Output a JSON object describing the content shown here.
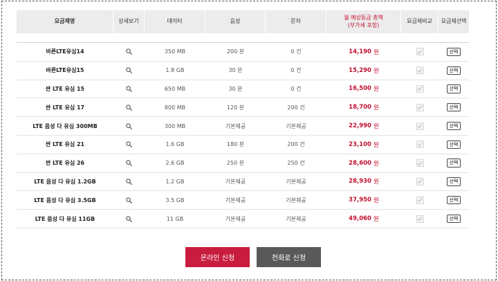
{
  "table": {
    "headers": {
      "plan": "요금제명",
      "detail": "상세보기",
      "data": "데이터",
      "voice": "음성",
      "sms": "문자",
      "monthly_line1": "월 예상동급 총액",
      "monthly_line2": "(부가세 포함)",
      "compare": "요금제비교",
      "select": "요금제선택"
    },
    "select_label": "선택",
    "won_unit": "원",
    "rows": [
      {
        "plan": "바른LTE유심14",
        "data": "350 MB",
        "voice": "200 분",
        "sms": "0 건",
        "price": "14,190"
      },
      {
        "plan": "바른LTE유심15",
        "data": "1.8 GB",
        "voice": "30 분",
        "sms": "0 건",
        "price": "15,290"
      },
      {
        "plan": "싼 LTE 유심 15",
        "data": "650 MB",
        "voice": "30 분",
        "sms": "0 건",
        "price": "16,500"
      },
      {
        "plan": "싼 LTE 유심 17",
        "data": "800 MB",
        "voice": "120 분",
        "sms": "200 건",
        "price": "18,700"
      },
      {
        "plan": "LTE 음성 다 유심 300MB",
        "data": "300 MB",
        "voice": "기본제공",
        "sms": "기본제공",
        "price": "22,990"
      },
      {
        "plan": "싼 LTE 유심 21",
        "data": "1.6 GB",
        "voice": "180 분",
        "sms": "200 건",
        "price": "23,100"
      },
      {
        "plan": "싼 LTE 유심 26",
        "data": "2.6 GB",
        "voice": "250 분",
        "sms": "250 건",
        "price": "28,600"
      },
      {
        "plan": "LTE 음성 다 유심 1.2GB",
        "data": "1.2 GB",
        "voice": "기본제공",
        "sms": "기본제공",
        "price": "28,930"
      },
      {
        "plan": "LTE 음성 다 유심 3.5GB",
        "data": "3.5 GB",
        "voice": "기본제공",
        "sms": "기본제공",
        "price": "37,950"
      },
      {
        "plan": "LTE 음성 다 유심 11GB",
        "data": "11 GB",
        "voice": "기본제공",
        "sms": "기본제공",
        "price": "49,060"
      }
    ]
  },
  "actions": {
    "online": "온라인 신청",
    "phone": "전화로 신청"
  },
  "colors": {
    "price": "#c0112f",
    "online_button": "#c81d3f",
    "phone_button": "#595959",
    "header_bg": "#ececec"
  },
  "icons": {
    "detail": "search-icon",
    "compare": "checkbox-icon"
  }
}
